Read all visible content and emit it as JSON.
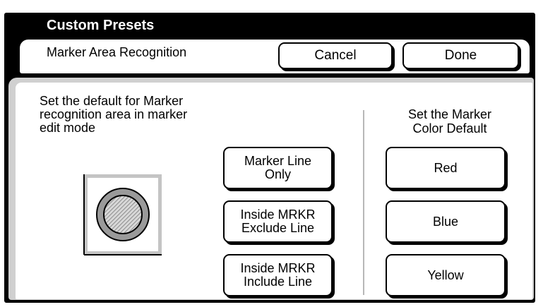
{
  "window": {
    "title": "Custom Presets"
  },
  "header": {
    "subtitle": "Marker Area Recognition",
    "cancel_label": "Cancel",
    "done_label": "Done"
  },
  "recognition": {
    "description_lines": [
      "Set the default for Marker",
      "recognition area in marker",
      "edit mode"
    ],
    "options": [
      {
        "line1": "Marker Line",
        "line2": "Only"
      },
      {
        "line1": "Inside MRKR",
        "line2": "Exclude Line"
      },
      {
        "line1": "Inside MRKR",
        "line2": "Include Line"
      }
    ],
    "illustration_icon": "marker-area-preview-icon"
  },
  "marker_color": {
    "title_lines": [
      "Set the Marker",
      "Color Default"
    ],
    "options": [
      "Red",
      "Blue",
      "Yellow"
    ]
  },
  "colors": {
    "frame": "#000000",
    "panel_border": "#d0d0d0",
    "divider": "#b8b8b8"
  }
}
